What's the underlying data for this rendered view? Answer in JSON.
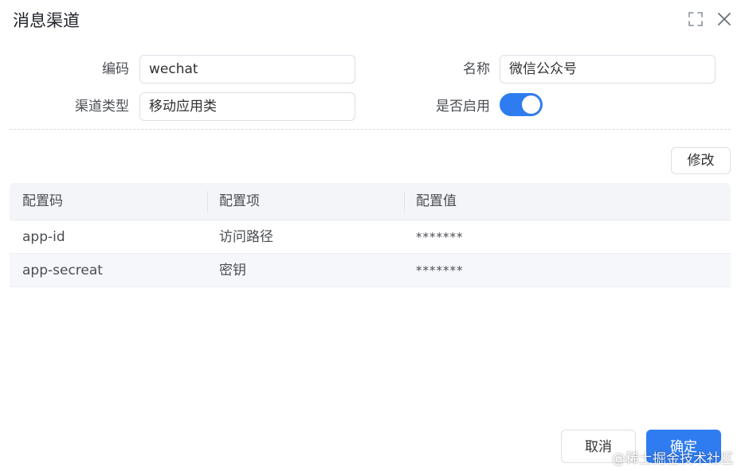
{
  "dialog": {
    "title": "消息渠道"
  },
  "form": {
    "code_label": "编码",
    "code_value": "wechat",
    "name_label": "名称",
    "name_value": "微信公众号",
    "type_label": "渠道类型",
    "type_value": "移动应用类",
    "enabled_label": "是否启用",
    "enabled": true
  },
  "toolbar": {
    "edit_label": "修改"
  },
  "table": {
    "headers": [
      "配置码",
      "配置项",
      "配置值"
    ],
    "rows": [
      [
        "app-id",
        "访问路径",
        "*******"
      ],
      [
        "app-secreat",
        "密钥",
        "*******"
      ]
    ]
  },
  "footer": {
    "cancel_label": "取消",
    "ok_label": "确定"
  },
  "watermark": "@稀土掘金技术社区",
  "colors": {
    "primary": "#2f7cf0",
    "stripe": "#f5f7fb",
    "header_bg": "#f3f5f8"
  }
}
